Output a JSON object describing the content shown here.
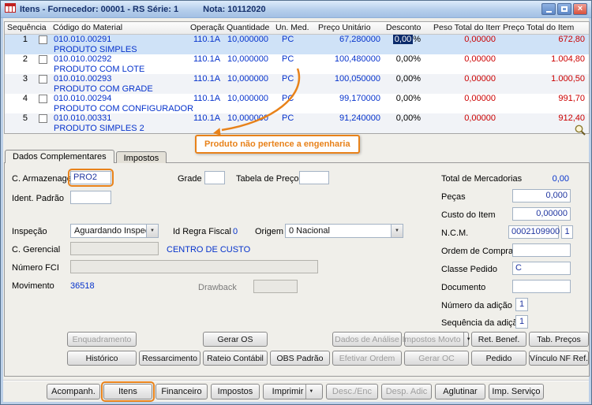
{
  "window": {
    "title": "Itens - Fornecedor: 00001 - RS Série: 1",
    "nota": "Nota: 10112020"
  },
  "icons": {
    "dropdown": "▼",
    "close": "×"
  },
  "colors": {
    "accent_orange": "#e8821a",
    "selection_blue": "#cfe2f7",
    "value_blue": "#0633cc",
    "value_red": "#cc0000"
  },
  "grid": {
    "headers": {
      "seq": "Sequência",
      "code": "Código do Material",
      "op": "Operação",
      "qty": "Quantidade",
      "um": "Un. Med.",
      "unit": "Preço Unitário",
      "disc": "Desconto",
      "weight": "Peso Total do Item",
      "total": "Preço Total do Item"
    },
    "rows": [
      {
        "seq": "1",
        "code": "010.010.00291",
        "name": "PRODUTO SIMPLES",
        "op": "110.1A",
        "qty": "10,000000",
        "um": "PC",
        "unit": "67,280000",
        "disc": "0,00",
        "pct": "%",
        "weight": "0,00000",
        "total": "672,80"
      },
      {
        "seq": "2",
        "code": "010.010.00292",
        "name": "PRODUTO COM LOTE",
        "op": "110.1A",
        "qty": "10,000000",
        "um": "PC",
        "unit": "100,480000",
        "disc": "0,00",
        "pct": "%",
        "weight": "0,00000",
        "total": "1.004,80"
      },
      {
        "seq": "3",
        "code": "010.010.00293",
        "name": "PRODUTO COM GRADE",
        "op": "110.1A",
        "qty": "10,000000",
        "um": "PC",
        "unit": "100,050000",
        "disc": "0,00",
        "pct": "%",
        "weight": "0,00000",
        "total": "1.000,50"
      },
      {
        "seq": "4",
        "code": "010.010.00294",
        "name": "PRODUTO COM CONFIGURADOR",
        "op": "110.1A",
        "qty": "10,000000",
        "um": "PC",
        "unit": "99,170000",
        "disc": "0,00",
        "pct": "%",
        "weight": "0,00000",
        "total": "991,70"
      },
      {
        "seq": "5",
        "code": "010.010.00331",
        "name": "PRODUTO SIMPLES 2",
        "op": "110.1A",
        "qty": "10,000000",
        "um": "PC",
        "unit": "91,240000",
        "disc": "0,00",
        "pct": "%",
        "weight": "0,00000",
        "total": "912,40"
      }
    ]
  },
  "callout": {
    "text": "Produto não pertence a engenharia"
  },
  "tabs": [
    {
      "label": "Dados Complementares"
    },
    {
      "label": "Impostos"
    }
  ],
  "form": {
    "c_armazenagem_label": "C. Armazenagem",
    "c_armazenagem_value": "PRO2",
    "grade_label": "Grade",
    "grade_value": "",
    "tabela_preco_label": "Tabela de Preço",
    "tabela_preco_value": "",
    "ident_padrao_label": "Ident. Padrão",
    "ident_padrao_value": "",
    "inspecao_label": "Inspeção",
    "inspecao_value": "Aguardando Inspeção",
    "id_regra_fiscal_label": "Id Regra Fiscal",
    "id_regra_fiscal_value": "0",
    "origem_label": "Origem",
    "origem_value": "0 Nacional",
    "c_gerencial_label": "C. Gerencial",
    "c_gerencial_value": "",
    "c_gerencial_note": "CENTRO DE CUSTO",
    "numero_fci_label": "Número FCI",
    "numero_fci_value": "",
    "movimento_label": "Movimento",
    "movimento_value": "36518",
    "drawback_label": "Drawback",
    "drawback_value": "",
    "total_mercadorias_label": "Total de Mercadorias",
    "total_mercadorias_value": "0,00",
    "pecas_label": "Peças",
    "pecas_value": "0,000",
    "custo_item_label": "Custo do Item",
    "custo_item_value": "0,00000",
    "ncm_label": "N.C.M.",
    "ncm_value": "0002109900",
    "ncm_ex_value": "1",
    "ordem_compra_label": "Ordem de Compra",
    "ordem_compra_value": "",
    "classe_pedido_label": "Classe Pedido",
    "classe_pedido_value": "C",
    "documento_label": "Documento",
    "documento_value": "",
    "numero_adicao_label": "Número da adição",
    "numero_adicao_value": "1",
    "seq_adicao_label": "Sequência da adição",
    "seq_adicao_value": "1"
  },
  "action_buttons": {
    "row1": [
      {
        "label": "Enquadramento",
        "disabled": true
      },
      {
        "label": "Gerar OS",
        "disabled": false
      },
      {
        "label": "Dados de Análise",
        "disabled": true
      },
      {
        "label": "Impostos Movto",
        "disabled": true,
        "dropdown": true
      },
      {
        "label": "Ret. Benef.",
        "disabled": false
      },
      {
        "label": "Tab. Preços",
        "disabled": false
      }
    ],
    "row2": [
      {
        "label": "Histórico",
        "disabled": false
      },
      {
        "label": "Ressarcimento",
        "disabled": false
      },
      {
        "label": "Rateio Contábil",
        "disabled": false
      },
      {
        "label": "OBS Padrão",
        "disabled": false
      },
      {
        "label": "Efetivar Ordem",
        "disabled": true
      },
      {
        "label": "Gerar OC",
        "disabled": true
      },
      {
        "label": "Pedido",
        "disabled": false
      },
      {
        "label": "Vínculo NF Ref.",
        "disabled": false
      }
    ]
  },
  "bottom_bar": [
    {
      "label": "Acompanh.",
      "disabled": false
    },
    {
      "label": "Itens",
      "disabled": false,
      "highlight": true
    },
    {
      "label": "Financeiro",
      "disabled": false
    },
    {
      "label": "Impostos",
      "disabled": false
    },
    {
      "label": "Imprimir",
      "disabled": false,
      "dropdown": true
    },
    {
      "label": "Desc./Enc",
      "disabled": true
    },
    {
      "label": "Desp. Adic",
      "disabled": true
    },
    {
      "label": "Aglutinar",
      "disabled": false
    },
    {
      "label": "Imp. Serviço",
      "disabled": false
    }
  ]
}
